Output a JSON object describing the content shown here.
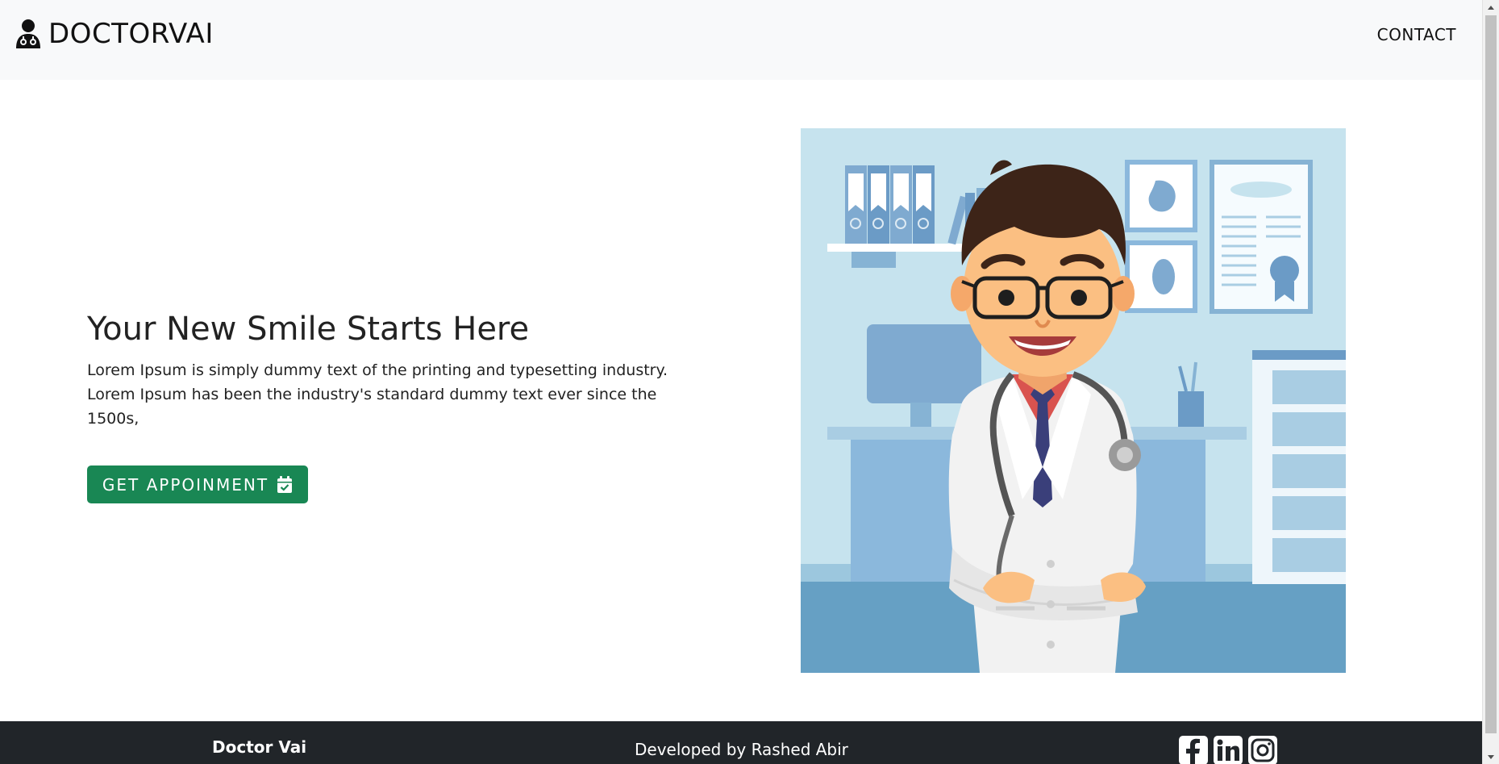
{
  "header": {
    "brand_name": "DOCTORVAI",
    "brand_icon": "doctor-icon",
    "nav": {
      "contact_label": "CONTACT"
    }
  },
  "hero": {
    "title": "Your New Smile Starts Here",
    "description": "Lorem Ipsum is simply dummy text of the printing and typesetting industry. Lorem Ipsum has been the industry's standard dummy text ever since the 1500s,",
    "cta_label": "GET APPOINMENT",
    "cta_icon": "calendar-check-icon",
    "illustration": "doctor-illustration"
  },
  "footer": {
    "brand": "Doctor Vai",
    "developer": "Developed by Rashed Abir",
    "social": [
      "facebook-icon",
      "linkedin-icon",
      "instagram-icon"
    ]
  },
  "colors": {
    "navbar_bg": "#f8f9fa",
    "cta_bg": "#198754",
    "footer_bg": "#212529",
    "illustration_bg": "#c6e3ee"
  }
}
